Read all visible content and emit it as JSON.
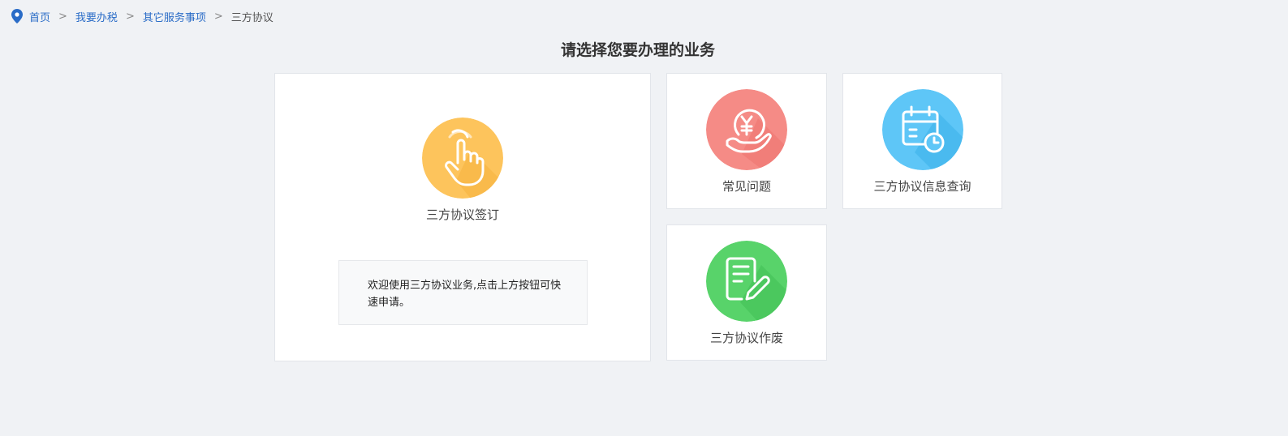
{
  "breadcrumb": {
    "items": [
      "首页",
      "我要办税",
      "其它服务事项"
    ],
    "current": "三方协议",
    "separator": ">"
  },
  "page_title": "请选择您要办理的业务",
  "cards": {
    "sign": {
      "label": "三方协议签订",
      "icon": "hand-pointer-icon",
      "color": "#fdc45c",
      "notice": "欢迎使用三方协议业务,点击上方按钮可快速申请。"
    },
    "faq": {
      "label": "常见问题",
      "icon": "yen-hand-icon",
      "color": "#f58b86"
    },
    "query": {
      "label": "三方协议信息查询",
      "icon": "calendar-clock-icon",
      "color": "#5ec6f7"
    },
    "void": {
      "label": "三方协议作废",
      "icon": "document-edit-icon",
      "color": "#58d36a"
    }
  }
}
